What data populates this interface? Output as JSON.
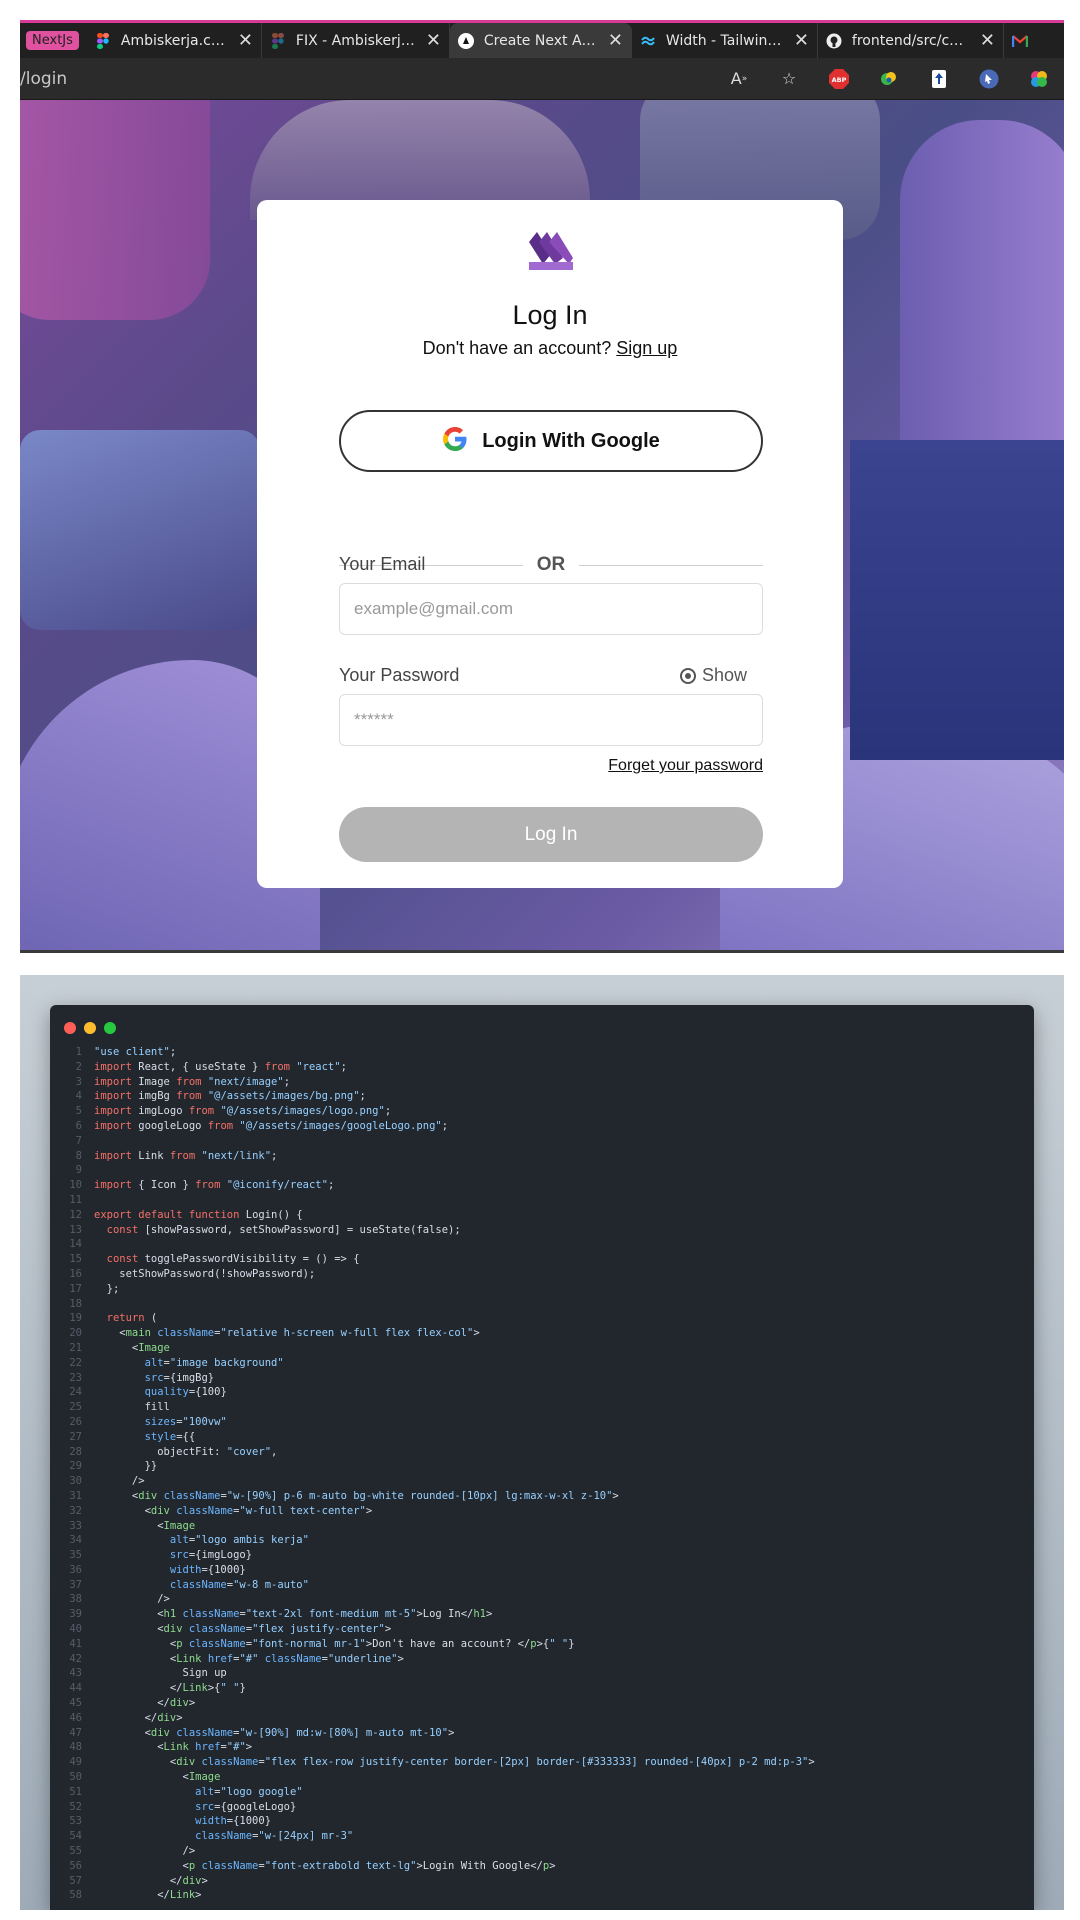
{
  "browser": {
    "tab_group": "NextJs",
    "tabs": [
      {
        "title": "Ambiskerja.com – I",
        "icon": "figma-icon"
      },
      {
        "title": "FIX - Ambiskerja.co",
        "icon": "figma-icon"
      },
      {
        "title": "Create Next App",
        "icon": "nextjs-icon",
        "active": true
      },
      {
        "title": "Width - Tailwind C",
        "icon": "tailwind-icon"
      },
      {
        "title": "frontend/src/comp",
        "icon": "github-icon"
      }
    ],
    "url": "/login"
  },
  "login": {
    "title": "Log In",
    "no_account": "Don't have an account?",
    "signup": "Sign up",
    "google_button": "Login With Google",
    "or": "OR",
    "email_label": "Your Email",
    "email_placeholder": "example@gmail.com",
    "password_label": "Your Password",
    "show": "Show",
    "password_placeholder": "******",
    "forgot": "Forget your password",
    "login_button": "Log In"
  },
  "colors": {
    "accent": "#7b3aa5",
    "button_disabled": "#b4b4b4",
    "tab_group": "#e0529f"
  },
  "code_lines": [
    "\"use client\";",
    "import React, { useState } from \"react\";",
    "import Image from \"next/image\";",
    "import imgBg from \"@/assets/images/bg.png\";",
    "import imgLogo from \"@/assets/images/logo.png\";",
    "import googleLogo from \"@/assets/images/googleLogo.png\";",
    "",
    "import Link from \"next/link\";",
    "",
    "import { Icon } from \"@iconify/react\";",
    "",
    "export default function Login() {",
    "  const [showPassword, setShowPassword] = useState(false);",
    "",
    "  const togglePasswordVisibility = () => {",
    "    setShowPassword(!showPassword);",
    "  };",
    "",
    "  return (",
    "    <main className=\"relative h-screen w-full flex flex-col\">",
    "      <Image",
    "        alt=\"image background\"",
    "        src={imgBg}",
    "        quality={100}",
    "        fill",
    "        sizes=\"100vw\"",
    "        style={{",
    "          objectFit: \"cover\",",
    "        }}",
    "      />",
    "      <div className=\"w-[90%] p-6 m-auto bg-white rounded-[10px] lg:max-w-xl z-10\">",
    "        <div className=\"w-full text-center\">",
    "          <Image",
    "            alt=\"logo ambis kerja\"",
    "            src={imgLogo}",
    "            width={1000}",
    "            className=\"w-8 m-auto\"",
    "          />",
    "          <h1 className=\"text-2xl font-medium mt-5\">Log In</h1>",
    "          <div className=\"flex justify-center\">",
    "            <p className=\"font-normal mr-1\">Don't have an account? </p>{\" \"}",
    "            <Link href=\"#\" className=\"underline\">",
    "              Sign up",
    "            </Link>{\" \"}",
    "          </div>",
    "        </div>",
    "        <div className=\"w-[90%] md:w-[80%] m-auto mt-10\">",
    "          <Link href=\"#\">",
    "            <div className=\"flex flex-row justify-center border-[2px] border-[#333333] rounded-[40px] p-2 md:p-3\">",
    "              <Image",
    "                alt=\"logo google\"",
    "                src={googleLogo}",
    "                width={1000}",
    "                className=\"w-[24px] mr-3\"",
    "              />",
    "              <p className=\"font-extrabold text-lg\">Login With Google</p>",
    "            </div>",
    "          </Link>"
  ]
}
